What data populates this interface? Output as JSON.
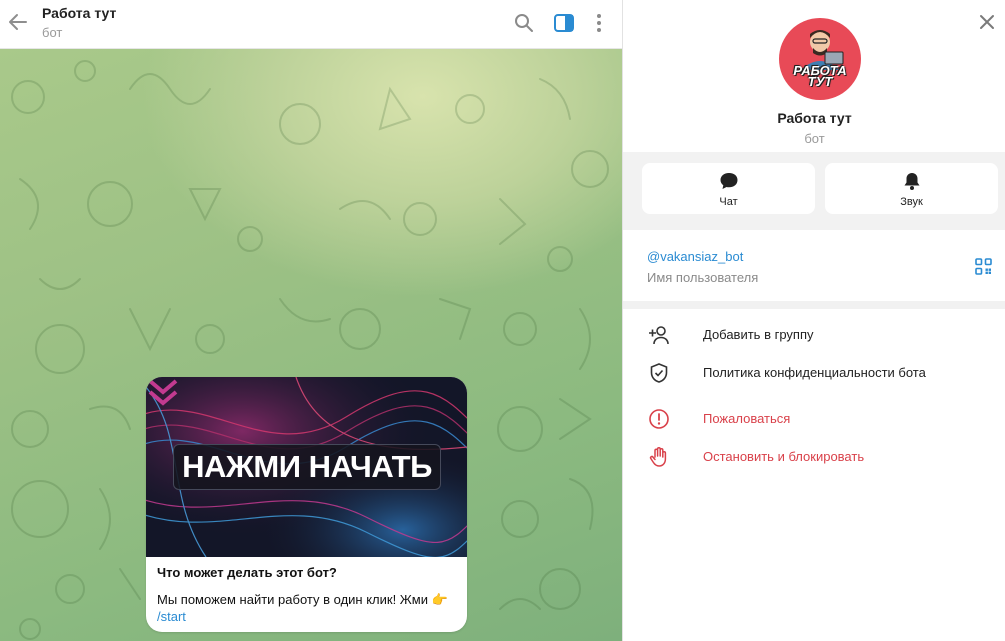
{
  "chat": {
    "title": "Работа тут",
    "subtitle": "бот",
    "card": {
      "banner_text": "НАЖМИ НАЧАТЬ",
      "question": "Что может делать этот бот?",
      "text": "Мы поможем найти работу в один клик! Жми 👉",
      "link": "/start"
    }
  },
  "panel": {
    "avatar_text_1": "РАБОТА",
    "avatar_text_2": "ТУТ",
    "name": "Работа тут",
    "subtitle": "бот",
    "actions": [
      {
        "label": "Чат",
        "icon": "chat-bubble-icon"
      },
      {
        "label": "Звук",
        "icon": "bell-icon"
      }
    ],
    "username": "@vakansiaz_bot",
    "username_label": "Имя пользователя",
    "menu": [
      {
        "label": "Добавить в группу",
        "icon": "add-user-icon",
        "danger": false
      },
      {
        "label": "Политика конфиденциальности бота",
        "icon": "shield-icon",
        "danger": false
      },
      {
        "label": "Пожаловаться",
        "icon": "report-icon",
        "danger": true
      },
      {
        "label": "Остановить и блокировать",
        "icon": "stop-hand-icon",
        "danger": true
      }
    ]
  },
  "colors": {
    "accent": "#2a8bd2",
    "danger": "#d9414a",
    "avatar_bg": "#e84a57",
    "wallpaper": "#9dc185"
  }
}
